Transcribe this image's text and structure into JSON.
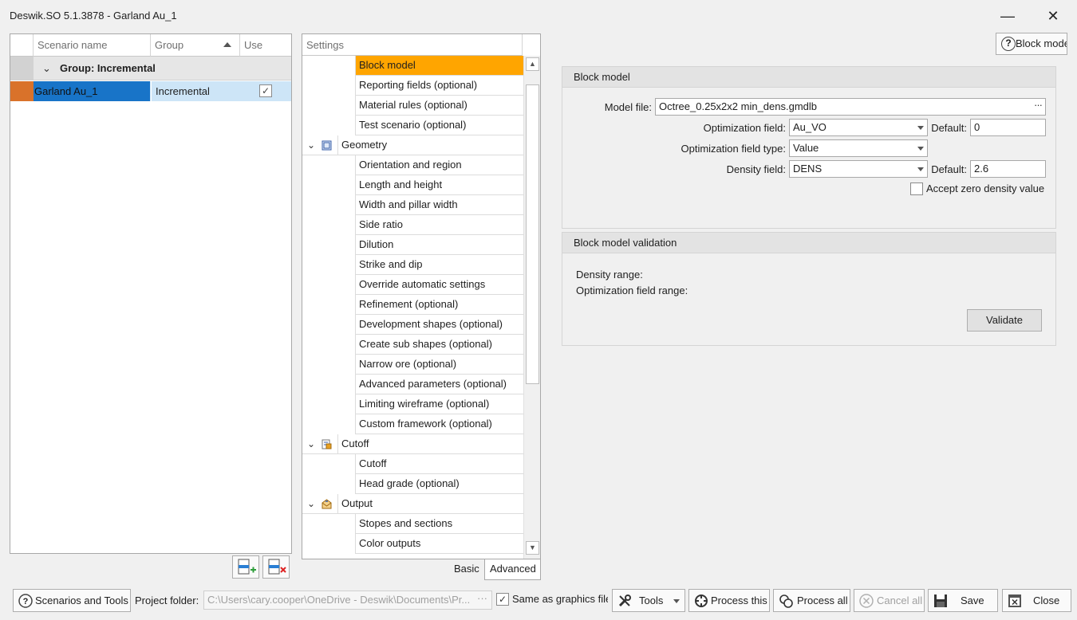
{
  "window": {
    "title": "Deswik.SO 5.1.3878 - Garland Au_1",
    "minimize_glyph": "—",
    "close_glyph": "✕"
  },
  "scenarios": {
    "columns": {
      "name": "Scenario name",
      "group": "Group",
      "use": "Use"
    },
    "group_row": {
      "label": "Group: Incremental",
      "chevron": "⌄"
    },
    "rows": [
      {
        "name": "Garland Au_1",
        "group": "Incremental",
        "use": true,
        "use_glyph": "✓",
        "color": "#d9722a"
      }
    ]
  },
  "settings": {
    "header": "Settings",
    "items": [
      {
        "label": "Block model",
        "selected": true
      },
      {
        "label": "Reporting fields (optional)"
      },
      {
        "label": "Material rules (optional)"
      },
      {
        "label": "Test scenario (optional)"
      }
    ],
    "categories": [
      {
        "label": "Geometry",
        "icon": "geometry-icon",
        "items": [
          "Orientation and region",
          "Length and height",
          "Width and pillar width",
          "Side ratio",
          "Dilution",
          "Strike and dip",
          "Override automatic settings",
          "Refinement (optional)",
          "Development shapes (optional)",
          "Create sub shapes (optional)",
          "Narrow ore (optional)",
          "Advanced parameters (optional)",
          "Limiting wireframe (optional)",
          "Custom framework (optional)"
        ]
      },
      {
        "label": "Cutoff",
        "icon": "cutoff-icon",
        "items": [
          "Cutoff",
          "Head grade (optional)"
        ]
      },
      {
        "label": "Output",
        "icon": "output-icon",
        "items": [
          "Stopes and sections",
          "Color outputs"
        ]
      }
    ],
    "chevron": "⌄",
    "tabs": {
      "basic": "Basic",
      "advanced": "Advanced"
    }
  },
  "mode_button": {
    "label": "Block mode",
    "icon": "help-icon",
    "glyph": "?"
  },
  "block_model": {
    "title": "Block model",
    "model_file_label": "Model file:",
    "model_file_value": "Octree_0.25x2x2 min_dens.gmdlb",
    "opt_field_label": "Optimization field:",
    "opt_field_value": "Au_VO",
    "default_label": "Default:",
    "opt_default_value": "0",
    "opt_type_label": "Optimization field type:",
    "opt_type_value": "Value",
    "density_label": "Density field:",
    "density_value": "DENS",
    "density_default_value": "2.6",
    "accept_zero_label": "Accept zero density value",
    "accept_zero_checked": false,
    "ellipsis": "···"
  },
  "validation": {
    "title": "Block model validation",
    "density_range_label": "Density range:",
    "opt_range_label": "Optimization field range:",
    "validate_label": "Validate"
  },
  "bottom": {
    "scenarios_tools": "Scenarios and Tools",
    "project_folder_label": "Project folder:",
    "project_folder_value": "C:\\Users\\cary.cooper\\OneDrive - Deswik\\Documents\\Pr...",
    "project_dots": "···",
    "same_as_graphics": "Same as graphics file",
    "same_checked_glyph": "✓",
    "tools": "Tools",
    "process_this": "Process this",
    "process_all": "Process all",
    "cancel_all": "Cancel all",
    "save": "Save",
    "close": "Close"
  },
  "colors": {
    "selected_item": "#ffa500",
    "row_highlight": "#cde5f7",
    "name_cell": "#1874c8",
    "scenario_color": "#d9722a"
  }
}
